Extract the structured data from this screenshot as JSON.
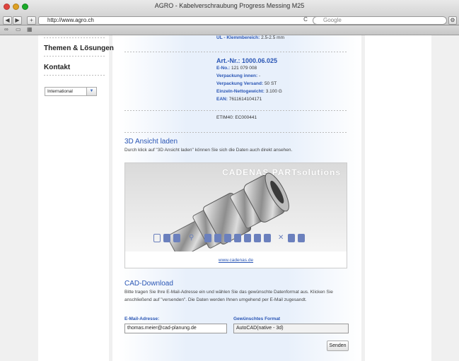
{
  "browser": {
    "title": "AGRO - Kabelverschraubung Progress Messing M25",
    "url": "http://www.agro.ch",
    "search_placeholder": "Google",
    "back_label": "◀",
    "forward_label": "▶",
    "add_label": "+",
    "reload_label": "C"
  },
  "sidebar": {
    "menu_1": "Themen & Lösungen",
    "menu_2": "Kontakt",
    "region_value": "International",
    "region_arrow": "▼"
  },
  "product": {
    "ul_label": "UL - Klemmbereich:",
    "ul_value": "2.5-2.5 mm",
    "art_nr": "Art.-Nr.: 1000.06.025",
    "e_no_label": "E-No.:",
    "e_no_value": "121 079 008",
    "vp_innen_label": "Verpackung innen:",
    "vp_innen_value": "-",
    "vp_versand_label": "Verpackung Versand:",
    "vp_versand_value": "50 ST",
    "gewicht_label": "Einzeln-Nettogewicht:",
    "gewicht_value": "3.100 G",
    "ean_label": "EAN:",
    "ean_value": "7611614104171",
    "etim": "ETIM40: EC000441"
  },
  "view3d": {
    "heading": "3D Ansicht laden",
    "text": "Durch klick auf \"3D Ansicht laden\" können Sie sich die Daten auch direkt ansehen.",
    "watermark": "CADENAS PARTsolutions",
    "link": "www.cadenas.de"
  },
  "cad": {
    "heading": "CAD-Download",
    "text": "Bitte tragen Sie Ihre E-Mail-Adresse ein und wählen Sie das gewünschte Datenformat aus. Klicken Sie anschließend auf \"versenden\". Die Daten werden Ihnen umgehend per E-Mail zugesandt.",
    "email_label": "E-Mail-Adresse:",
    "email_value": "thomas.meier@cad-planung.de",
    "format_label": "Gewünschtes Format",
    "format_value": "AutoCAD(native - 3d)",
    "send_label": "Senden"
  },
  "colors": {
    "accent": "#2a56b5",
    "panel": "#e8f0fb"
  }
}
